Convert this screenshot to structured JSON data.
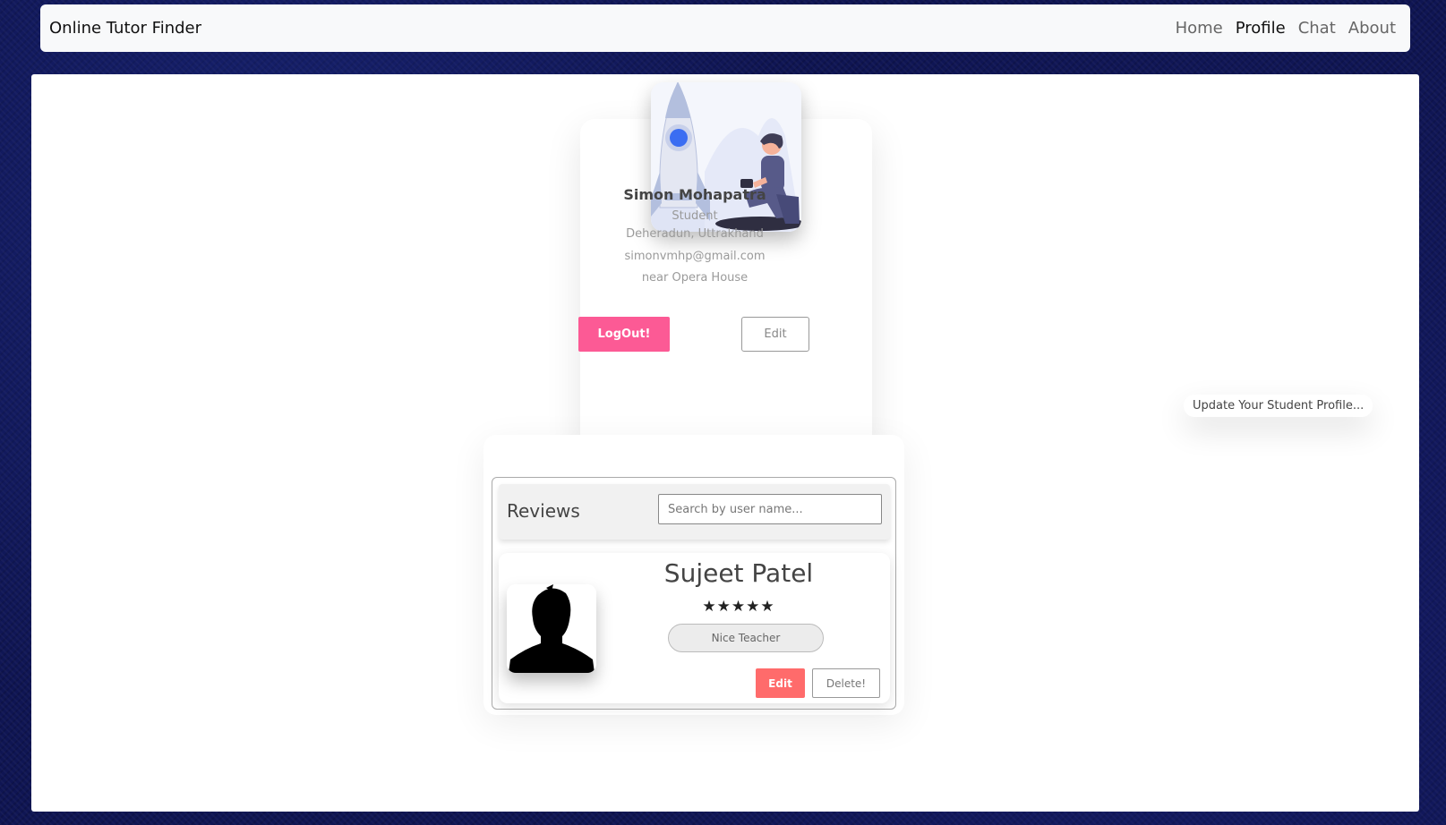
{
  "navbar": {
    "brand": "Online Tutor Finder",
    "links": [
      {
        "label": "Home",
        "active": false
      },
      {
        "label": "Profile",
        "active": true
      },
      {
        "label": "Chat",
        "active": false
      },
      {
        "label": "About",
        "active": false
      }
    ]
  },
  "profile": {
    "name": "Simon Mohapatra",
    "role": "Student",
    "location": "Deheradun, Uttrakhand",
    "email": "simonvmhp@gmail.com",
    "address": "near Opera House",
    "logout_label": "LogOut!",
    "edit_label": "Edit",
    "illustration": "rocket-person-illustration"
  },
  "toast": {
    "text": "Update Your Student Profile..."
  },
  "reviews": {
    "title": "Reviews",
    "search_placeholder": "Search by user name...",
    "items": [
      {
        "name": "Sujeet Patel",
        "stars": "★★★★★",
        "rating": 5,
        "text": "Nice Teacher",
        "edit_label": "Edit",
        "delete_label": "Delete!",
        "avatar_icon": "user-silhouette-icon"
      }
    ]
  },
  "colors": {
    "background": "#0f1553",
    "logout_button": "#fc5a95",
    "review_edit_button": "#ff6b6b"
  }
}
